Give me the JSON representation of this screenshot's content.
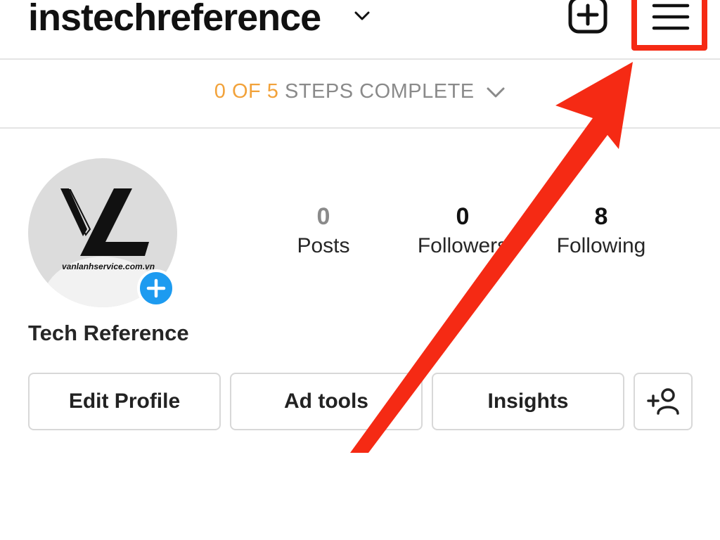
{
  "header": {
    "username": "instechreference",
    "username_icon": "chevron-down-icon",
    "new_post_icon": "plus-square-icon",
    "menu_icon": "hamburger-menu-icon",
    "highlight_color": "#f52a14"
  },
  "steps": {
    "count": "0 OF 5",
    "label": " STEPS COMPLETE",
    "accent_color": "#f2a23a"
  },
  "profile": {
    "watermark_text": "vanlanhservice.com.vn",
    "add_photo_icon": "plus-icon",
    "display_name": "Tech Reference",
    "stats": [
      {
        "value": "0",
        "label": "Posts"
      },
      {
        "value": "0",
        "label": "Followers"
      },
      {
        "value": "8",
        "label": "Following"
      }
    ]
  },
  "actions": {
    "edit_profile": "Edit Profile",
    "ad_tools": "Ad tools",
    "insights": "Insights",
    "discover_people_icon": "add-person-icon"
  }
}
